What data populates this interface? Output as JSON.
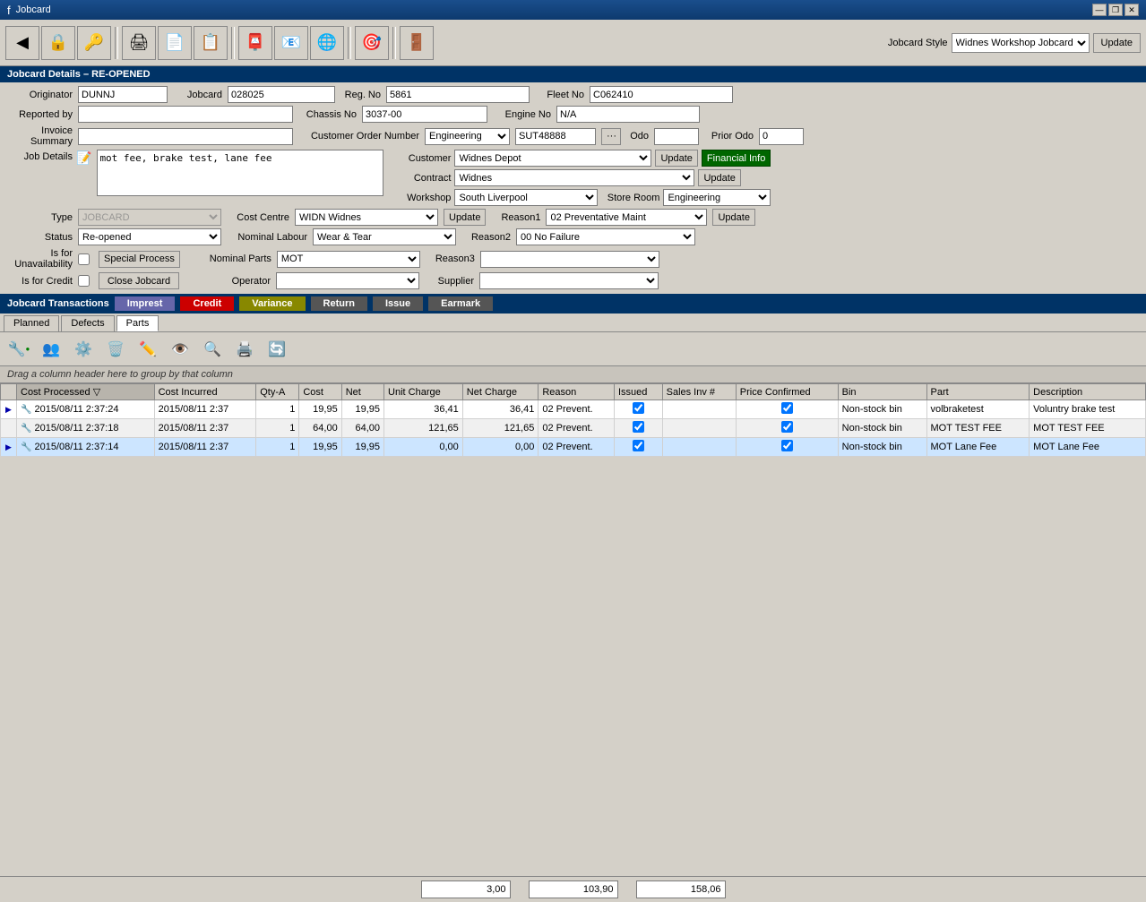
{
  "titleBar": {
    "title": "Jobcard",
    "minBtn": "—",
    "maxBtn": "❐",
    "closeBtn": "✕"
  },
  "toolbar": {
    "style_label": "Jobcard Style",
    "style_value": "Widnes Workshop Jobcard",
    "update_label": "Update",
    "icons": [
      "🔒",
      "🔑",
      "👤",
      "💾",
      "🖨",
      "📄",
      "📋",
      "📮",
      "📧",
      "🌐",
      "🎯",
      "🚪"
    ]
  },
  "jobcardDetails": {
    "header": "Jobcard Details – RE-OPENED",
    "originator_label": "Originator",
    "originator_value": "DUNNJ",
    "jobcard_label": "Jobcard",
    "jobcard_value": "028025",
    "reg_no_label": "Reg. No",
    "reg_no_value": "5861",
    "fleet_no_label": "Fleet No",
    "fleet_no_value": "C062410",
    "reported_by_label": "Reported by",
    "reported_by_value": "",
    "chassis_no_label": "Chassis No",
    "chassis_no_value": "3037-00",
    "engine_no_label": "Engine No",
    "engine_no_value": "N/A",
    "invoice_summary_label": "Invoice Summary",
    "invoice_summary_value": "",
    "customer_order_label": "Customer Order Number",
    "customer_order_value": "Engineering",
    "customer_order_suffix": "SUT48888",
    "odo_label": "Odo",
    "odo_value": "",
    "prior_odo_label": "Prior Odo",
    "prior_odo_value": "0",
    "job_details_label": "Job Details",
    "job_details_value": "mot fee, brake test, lane fee",
    "customer_label": "Customer",
    "customer_value": "Widnes Depot",
    "customer_update": "Update",
    "financial_info": "Financial Info",
    "contract_label": "Contract",
    "contract_value": "Widnes",
    "contract_update": "Update",
    "workshop_label": "Workshop",
    "workshop_value": "South Liverpool",
    "store_room_label": "Store Room",
    "store_room_value": "Engineering",
    "type_label": "Type",
    "type_value": "JOBCARD",
    "cost_centre_label": "Cost Centre",
    "cost_centre_value": "WIDN Widnes",
    "cost_centre_update": "Update",
    "reason1_label": "Reason1",
    "reason1_value": "02 Preventative Maint",
    "reason1_update": "Update",
    "status_label": "Status",
    "status_value": "Re-opened",
    "nominal_labour_label": "Nominal Labour",
    "nominal_labour_value": "Wear & Tear",
    "reason2_label": "Reason2",
    "reason2_value": "00 No Failure",
    "unavailability_label": "Is for Unavailability",
    "special_process": "Special Process",
    "nominal_parts_label": "Nominal Parts",
    "nominal_parts_value": "MOT",
    "reason3_label": "Reason3",
    "reason3_value": "",
    "credit_label": "Is for Credit",
    "close_jobcard": "Close Jobcard",
    "operator_label": "Operator",
    "operator_value": "",
    "supplier_label": "Supplier",
    "supplier_value": ""
  },
  "transactions": {
    "header": "Jobcard Transactions",
    "badges": [
      "Imprest",
      "Credit",
      "Variance",
      "Return",
      "Issue",
      "Earmark"
    ],
    "tabs": [
      "Planned",
      "Defects",
      "Parts"
    ],
    "active_tab": "Parts",
    "drag_info": "Drag a column header here to group by that column",
    "columns": [
      "",
      "Cost Processed",
      "Cost Incurred",
      "Qty-A",
      "Cost",
      "Net",
      "Unit Charge",
      "Net Charge",
      "Reason",
      "Issued",
      "Sales Inv #",
      "Price Confirmed",
      "Bin",
      "Part",
      "Description"
    ],
    "rows": [
      {
        "nav": "▶",
        "icon": "🔧",
        "cost_processed": "2015/08/11 2:37:24",
        "cost_incurred": "2015/08/11 2:37",
        "qty_a": "1",
        "cost": "19,95",
        "net": "19,95",
        "unit_charge": "36,41",
        "net_charge": "36,41",
        "reason": "02 Prevent.",
        "issued": true,
        "sales_inv": "",
        "price_confirmed": true,
        "bin": "Non-stock bin",
        "part": "volbraketest",
        "description": "Voluntry brake test"
      },
      {
        "nav": "",
        "icon": "🔧",
        "cost_processed": "2015/08/11 2:37:18",
        "cost_incurred": "2015/08/11 2:37",
        "qty_a": "1",
        "cost": "64,00",
        "net": "64,00",
        "unit_charge": "121,65",
        "net_charge": "121,65",
        "reason": "02 Prevent.",
        "issued": true,
        "sales_inv": "",
        "price_confirmed": true,
        "bin": "Non-stock bin",
        "part": "MOT TEST FEE",
        "description": "MOT TEST FEE"
      },
      {
        "nav": "▶",
        "icon": "🔧",
        "cost_processed": "2015/08/11 2:37:14",
        "cost_incurred": "2015/08/11 2:37",
        "qty_a": "1",
        "cost": "19,95",
        "net": "19,95",
        "unit_charge": "0,00",
        "net_charge": "0,00",
        "reason": "02 Prevent.",
        "issued": true,
        "sales_inv": "",
        "price_confirmed": true,
        "bin": "Non-stock bin",
        "part": "MOT Lane Fee",
        "description": "MOT Lane Fee"
      }
    ],
    "summary": {
      "qty_total": "3,00",
      "cost_total": "103,90",
      "net_total": "158,06"
    }
  }
}
